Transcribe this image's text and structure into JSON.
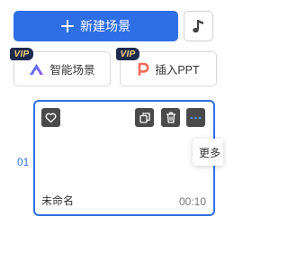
{
  "toolbar": {
    "new_scene_label": "新建场景",
    "music_icon": "music-note-icon"
  },
  "tools": {
    "smart_scene": {
      "label": "智能场景",
      "badge": "VIP",
      "icon": "ai-logo-icon"
    },
    "insert_ppt": {
      "label": "插入PPT",
      "badge": "VIP",
      "icon": "ppt-icon"
    }
  },
  "scenes": [
    {
      "index": "01",
      "name": "未命名",
      "duration": "00:10",
      "selected": true
    }
  ],
  "card_actions": {
    "favorite_icon": "heart-icon",
    "copy_icon": "copy-icon",
    "delete_icon": "trash-icon",
    "more_icon": "more-icon"
  },
  "tooltip": {
    "text": "更多"
  },
  "colors": {
    "accent": "#2f6fe6",
    "icon_button_bg": "#4a4a4a",
    "vip_bg": "#1f2a4d",
    "vip_text": "#f3cf7a",
    "ppt_icon": "#f26b5b"
  }
}
